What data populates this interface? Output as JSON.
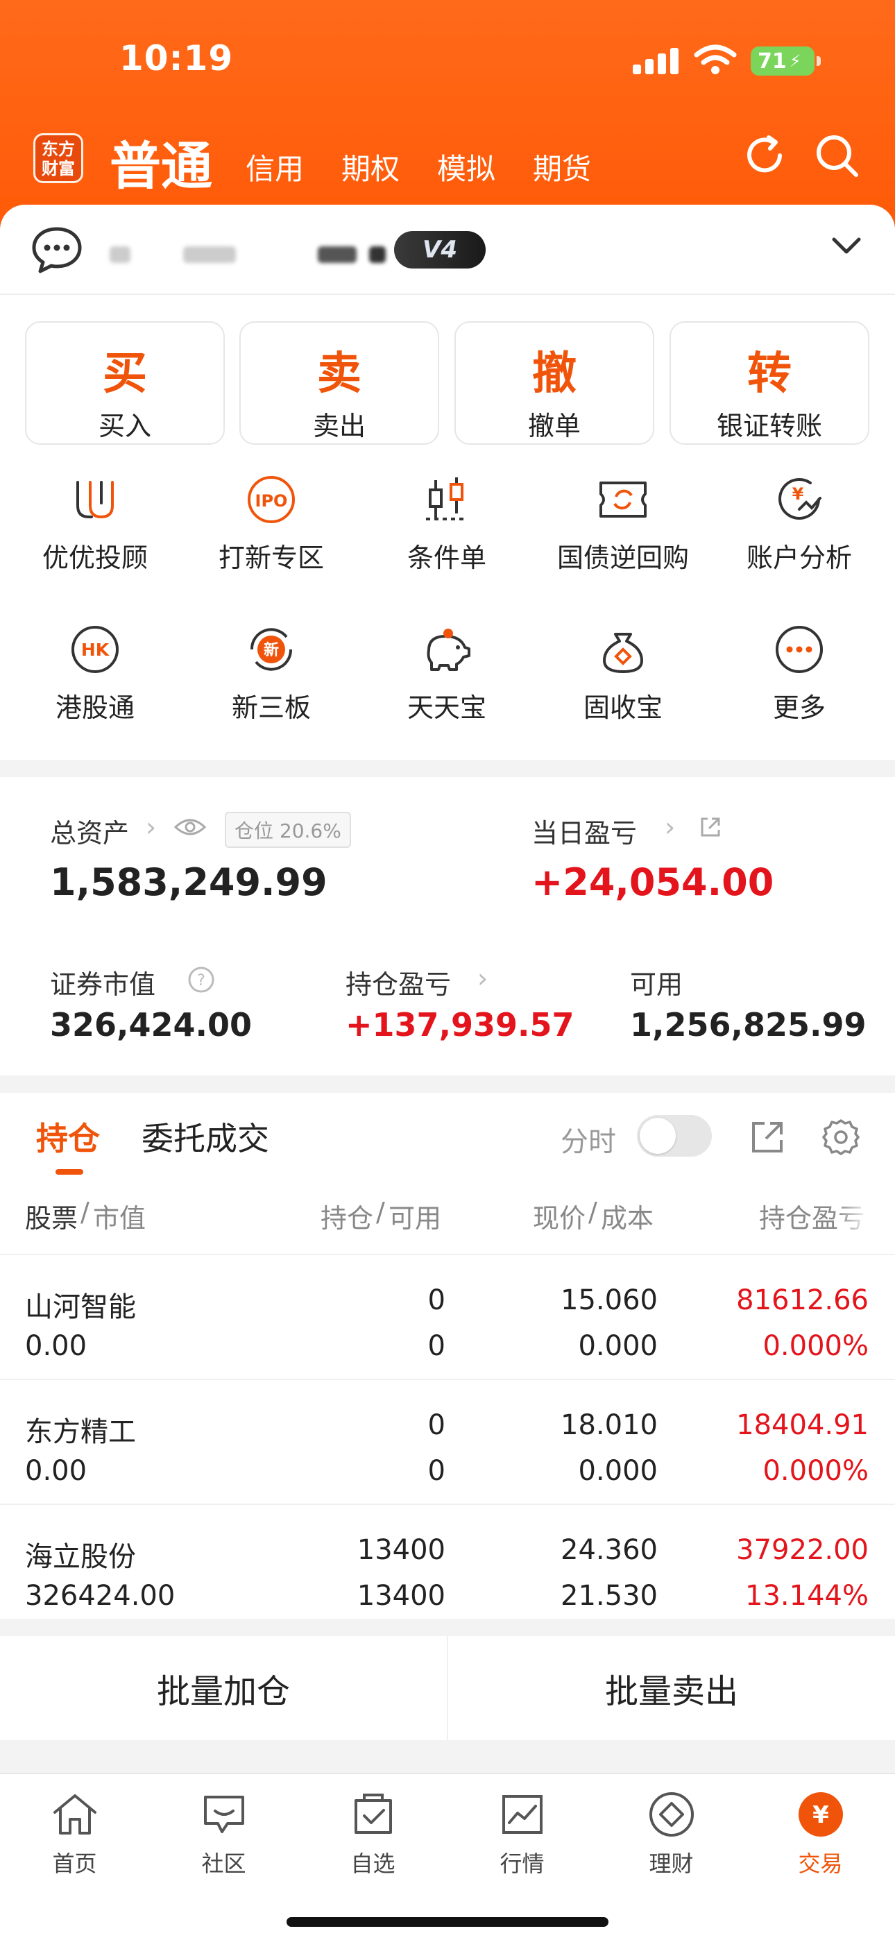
{
  "status": {
    "time": "10:19",
    "battery": "71"
  },
  "nav": {
    "logo_line1": "东方",
    "logo_line2": "财富",
    "main": "普通",
    "tabs": [
      "信用",
      "期权",
      "模拟",
      "期货"
    ]
  },
  "account": {
    "level_badge": "V4"
  },
  "quick_actions": [
    {
      "glyph": "买",
      "label": "买入"
    },
    {
      "glyph": "卖",
      "label": "卖出"
    },
    {
      "glyph": "撤",
      "label": "撤单"
    },
    {
      "glyph": "转",
      "label": "银证转账"
    }
  ],
  "functions": [
    {
      "label": "优优投顾",
      "icon": "uu-advisor-icon"
    },
    {
      "label": "打新专区",
      "icon": "ipo-icon"
    },
    {
      "label": "条件单",
      "icon": "candlestick-icon"
    },
    {
      "label": "国债逆回购",
      "icon": "repo-icon"
    },
    {
      "label": "账户分析",
      "icon": "analysis-icon"
    },
    {
      "label": "港股通",
      "icon": "hk-icon"
    },
    {
      "label": "新三板",
      "icon": "neeq-icon"
    },
    {
      "label": "天天宝",
      "icon": "piggy-bank-icon"
    },
    {
      "label": "固收宝",
      "icon": "money-bag-icon"
    },
    {
      "label": "更多",
      "icon": "more-icon"
    }
  ],
  "assets": {
    "total_label": "总资产",
    "total_value": "1,583,249.99",
    "position_tag": "仓位 20.6%",
    "daily_pnl_label": "当日盈亏",
    "daily_pnl_value": "+24,054.00",
    "market_value_label": "证券市值",
    "market_value": "326,424.00",
    "holding_pnl_label": "持仓盈亏",
    "holding_pnl_value": "+137,939.57",
    "available_label": "可用",
    "available_value": "1,256,825.99"
  },
  "holdings": {
    "tab_active": "持仓",
    "tab_other": "委托成交",
    "timeshare_label": "分时",
    "headers": {
      "col1a": "股票",
      "col1b": "市值",
      "col2a": "持仓",
      "col2b": "可用",
      "col3a": "现价",
      "col3b": "成本",
      "col4": "持仓盈亏"
    },
    "rows": [
      {
        "name": "山河智能",
        "mv": "0.00",
        "pos": "0",
        "avail": "0",
        "price": "15.060",
        "cost": "0.000",
        "pnl": "81612.66",
        "pct": "0.000%"
      },
      {
        "name": "东方精工",
        "mv": "0.00",
        "pos": "0",
        "avail": "0",
        "price": "18.010",
        "cost": "0.000",
        "pnl": "18404.91",
        "pct": "0.000%"
      },
      {
        "name": "海立股份",
        "mv": "326424.00",
        "pos": "13400",
        "avail": "13400",
        "price": "24.360",
        "cost": "21.530",
        "pnl": "37922.00",
        "pct": "13.144%"
      }
    ]
  },
  "bulk": {
    "add": "批量加仓",
    "sell": "批量卖出"
  },
  "tabbar": [
    {
      "label": "首页",
      "icon": "home-icon"
    },
    {
      "label": "社区",
      "icon": "community-icon"
    },
    {
      "label": "自选",
      "icon": "watchlist-icon"
    },
    {
      "label": "行情",
      "icon": "market-icon"
    },
    {
      "label": "理财",
      "icon": "wealth-icon"
    },
    {
      "label": "交易",
      "icon": "trade-icon"
    }
  ],
  "colors": {
    "brand": "#ff5a08",
    "accent": "#f0540a",
    "up": "#e3141b"
  }
}
